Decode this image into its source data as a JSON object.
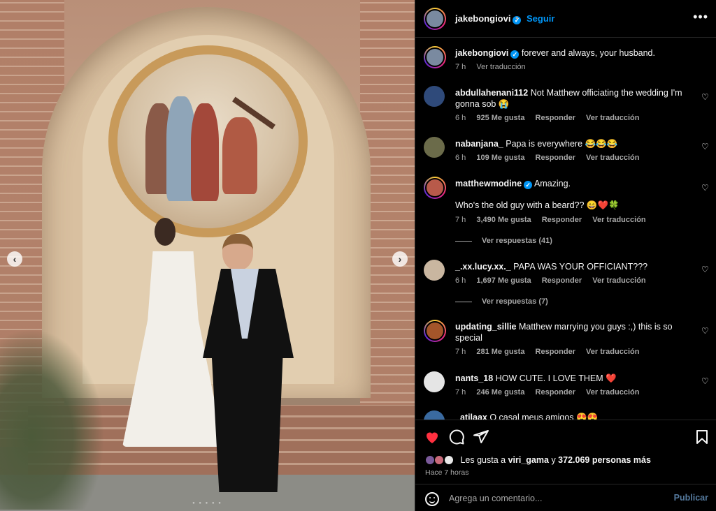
{
  "photo": {
    "prev_glyph": "‹",
    "next_glyph": "›",
    "dots": "● ● ● ● ●"
  },
  "header": {
    "username": "jakebongiovi",
    "separator": "•",
    "follow_label": "Seguir",
    "more_glyph": "•••"
  },
  "caption": {
    "username": "jakebongiovi",
    "text": "forever and always, your husband.",
    "time": "7 h",
    "translate": "Ver traducción"
  },
  "comments": [
    {
      "username": "abdullahenani112",
      "text": "Not Matthew officiating the wedding I'm gonna sob 😭",
      "time": "6 h",
      "likes": "925 Me gusta",
      "reply": "Responder",
      "translate": "Ver traducción",
      "avatar_color": "#2f4a7a"
    },
    {
      "username": "nabanjana_",
      "text": "Papa is everywhere 😂😂😂",
      "time": "6 h",
      "likes": "109 Me gusta",
      "reply": "Responder",
      "translate": "Ver traducción",
      "avatar_color": "#6b6b4a"
    },
    {
      "username": "matthewmodine",
      "verified": true,
      "text": "Amazing.",
      "text2": "Who's the old guy with a beard?? 😄❤️🍀",
      "time": "7 h",
      "likes": "3,490 Me gusta",
      "reply": "Responder",
      "translate": "Ver traducción",
      "replies": "Ver respuestas (41)",
      "avatar_color": "#b85a4a"
    },
    {
      "username": "_.xx.lucy.xx._",
      "text": "PAPA WAS YOUR OFFICIANT???",
      "time": "6 h",
      "likes": "1,697 Me gusta",
      "reply": "Responder",
      "translate": "Ver traducción",
      "replies": "Ver respuestas (7)",
      "avatar_color": "#c9b6a0"
    },
    {
      "username": "updating_sillie",
      "text": "Matthew marrying you guys :,) this is so special",
      "time": "7 h",
      "likes": "281 Me gusta",
      "reply": "Responder",
      "translate": "Ver traducción",
      "avatar_color": "#a4552a"
    },
    {
      "username": "nants_18",
      "text": "HOW CUTE. I LOVE THEM ❤️",
      "time": "7 h",
      "likes": "246 Me gusta",
      "reply": "Responder",
      "translate": "Ver traducción",
      "avatar_color": "#e5e5e5"
    },
    {
      "username": "_atilaax",
      "text": "O casal meus amigos 😍😍",
      "avatar_color": "#3a6aa0"
    }
  ],
  "actions": {
    "likes_prefix": "Les gusta a",
    "likes_user": "viri_gama",
    "likes_join": "y",
    "likes_count": "372.069 personas más",
    "time": "Hace 7 horas"
  },
  "composer": {
    "placeholder": "Agrega un comentario...",
    "publish_label": "Publicar"
  },
  "colors": {
    "accent": "#0095f6",
    "heart": "#ff3040"
  }
}
